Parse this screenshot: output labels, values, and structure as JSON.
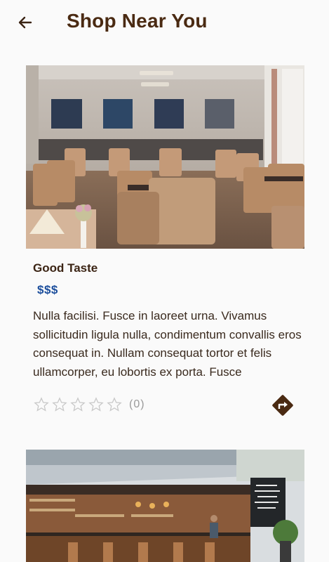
{
  "header": {
    "title": "Shop Near You",
    "back_icon": "arrow-left-icon"
  },
  "cards": [
    {
      "name": "Good Taste",
      "price": "$$$",
      "description": "Nulla facilisi. Fusce in laoreet urna. Vivamus sollicitudin ligula nulla, condimentum convallis eros consequat in. Nullam consequat tortor et felis ullamcorper, eu lobortis ex porta. Fusce",
      "rating": 0,
      "rating_max": 5,
      "review_count": "(0)",
      "directions_icon": "directions-icon"
    },
    {
      "name": "",
      "price": ""
    }
  ],
  "colors": {
    "brand_brown": "#4a2a12",
    "price_blue": "#1c4e9c",
    "star_outline": "#c8c8c8"
  }
}
